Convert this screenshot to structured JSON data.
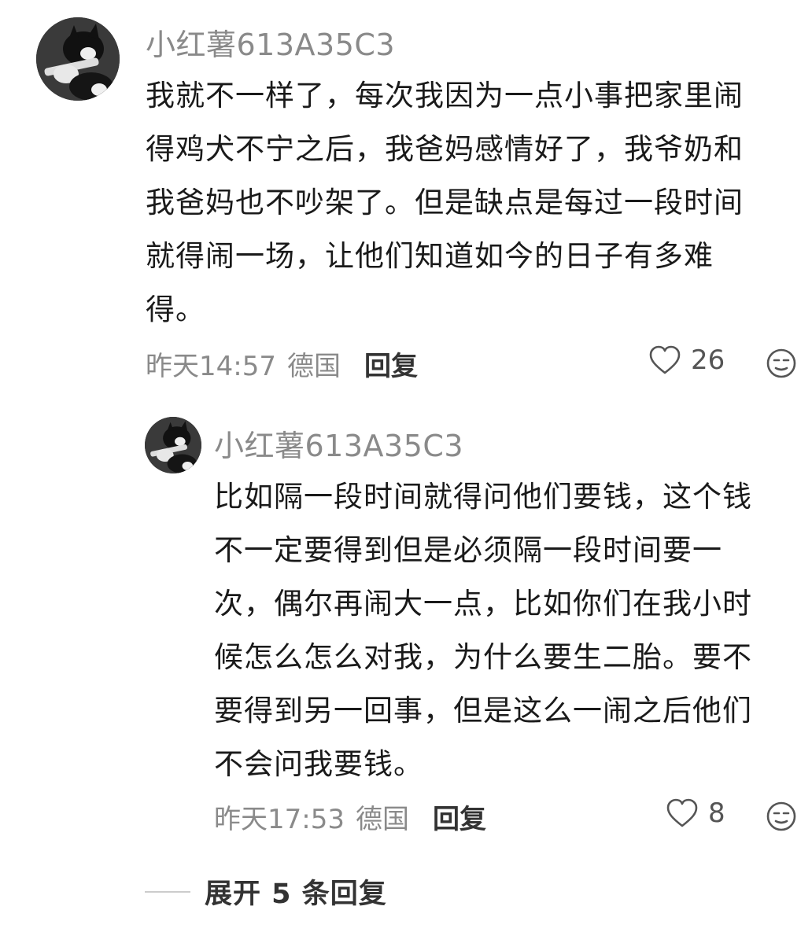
{
  "comments": [
    {
      "username": "小红薯613A35C3",
      "text": "我就不一样了，每次我因为一点小事把家里闹\n得鸡犬不宁之后，我爸妈感情好了，我爷奶和\n我爸妈也不吵架了。但是缺点是每过一段时间\n就得闹一场，让他们知道如今的日子有多难\n得。",
      "time": "昨天14:57",
      "location": "德国",
      "reply_label": "回复",
      "likes": "26",
      "avatar_icon": "cat-guitar-avatar-icon"
    }
  ],
  "replies": [
    {
      "username": "小红薯613A35C3",
      "text": "比如隔一段时间就得问他们要钱，这个钱\n不一定要得到但是必须隔一段时间要一\n次，偶尔再闹大一点，比如你们在我小时\n候怎么怎么对我，为什么要生二胎。要不\n要得到另一回事，但是这么一闹之后他们\n不会问我要钱。",
      "time": "昨天17:53",
      "location": "德国",
      "reply_label": "回复",
      "likes": "8",
      "avatar_icon": "cat-guitar-avatar-icon"
    }
  ],
  "expand": {
    "label": "展开 5 条回复"
  },
  "colors": {
    "text": "#1a1a1a",
    "muted": "#8a8a8a",
    "background": "#ffffff"
  }
}
